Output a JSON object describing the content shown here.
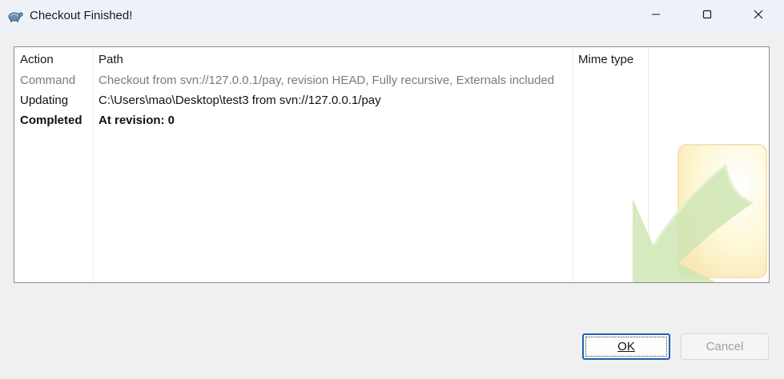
{
  "window": {
    "title": "Checkout Finished!",
    "icons": {
      "app": "tortoise-icon",
      "minimize": "minimize-icon",
      "maximize": "maximize-icon",
      "close": "close-icon"
    }
  },
  "list": {
    "columns": [
      "Action",
      "Path",
      "Mime type"
    ],
    "rows": [
      {
        "action": "Command",
        "path": "Checkout from svn://127.0.0.1/pay, revision HEAD, Fully recursive, Externals included",
        "mime": "",
        "style": "gray"
      },
      {
        "action": "Updating",
        "path": "C:\\Users\\mao\\Desktop\\test3 from svn://127.0.0.1/pay",
        "mime": "",
        "style": "normal"
      },
      {
        "action": "Completed",
        "path": "At revision: 0",
        "mime": "",
        "style": "bold"
      }
    ],
    "watermark_icon": "checkmark-watermark-icon"
  },
  "buttons": {
    "ok_label": "OK",
    "cancel_label": "Cancel",
    "cancel_enabled": false
  },
  "colors": {
    "titlebar_bg": "#eef2f8",
    "dialog_bg": "#f0f0f0",
    "ok_border": "#1d5fb4",
    "muted_text": "#7a7a7a",
    "disabled_text": "#a0a0a0"
  }
}
